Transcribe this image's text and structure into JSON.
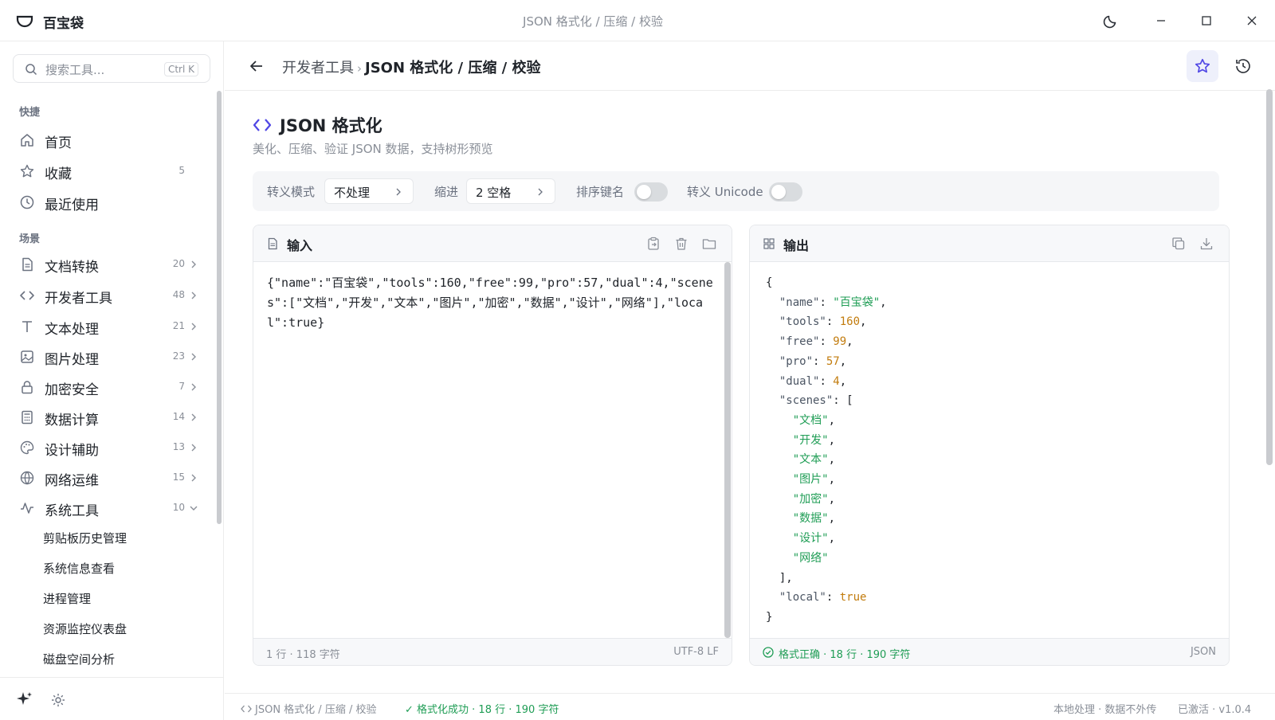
{
  "app": {
    "name": "百宝袋",
    "window_title": "JSON 格式化 / 压缩 / 校验"
  },
  "sidebar": {
    "search_placeholder": "搜索工具...",
    "search_shortcut": "Ctrl K",
    "quick_title": "快捷",
    "quick_items": [
      {
        "label": "首页",
        "icon": "home-icon"
      },
      {
        "label": "收藏",
        "icon": "star-icon",
        "count": "5"
      },
      {
        "label": "最近使用",
        "icon": "clock-icon"
      }
    ],
    "scene_title": "场景",
    "scene_items": [
      {
        "label": "文档转换",
        "icon": "document-icon",
        "count": "20"
      },
      {
        "label": "开发者工具",
        "icon": "code-icon",
        "count": "48"
      },
      {
        "label": "文本处理",
        "icon": "text-icon",
        "count": "21"
      },
      {
        "label": "图片处理",
        "icon": "image-icon",
        "count": "23"
      },
      {
        "label": "加密安全",
        "icon": "lock-icon",
        "count": "7"
      },
      {
        "label": "数据计算",
        "icon": "calculator-icon",
        "count": "14"
      },
      {
        "label": "设计辅助",
        "icon": "palette-icon",
        "count": "13"
      },
      {
        "label": "网络运维",
        "icon": "globe-icon",
        "count": "15"
      },
      {
        "label": "系统工具",
        "icon": "activity-icon",
        "count": "10",
        "expanded": true
      }
    ],
    "sub_items": [
      "剪贴板历史管理",
      "系统信息查看",
      "进程管理",
      "资源监控仪表盘",
      "磁盘空间分析"
    ]
  },
  "header": {
    "breadcrumb_parent": "开发者工具",
    "breadcrumb_sep": "›",
    "breadcrumb_current": "JSON 格式化 / 压缩 / 校验"
  },
  "tool": {
    "title": "JSON 格式化",
    "description": "美化、压缩、验证 JSON 数据，支持树形预览"
  },
  "options": {
    "escape_mode_label": "转义模式",
    "escape_mode_value": "不处理",
    "indent_label": "缩进",
    "indent_value": "2 空格",
    "sort_keys_label": "排序键名",
    "sort_keys_on": false,
    "unicode_label": "转义 Unicode",
    "unicode_on": false
  },
  "input_panel": {
    "title": "输入",
    "content": "{\"name\":\"百宝袋\",\"tools\":160,\"free\":99,\"pro\":57,\"dual\":4,\"scenes\":[\"文档\",\"开发\",\"文本\",\"图片\",\"加密\",\"数据\",\"设计\",\"网络\"],\"local\":true}",
    "footer_left": "1 行 · 118 字符",
    "footer_right": "UTF-8   LF"
  },
  "output_panel": {
    "title": "输出",
    "footer_left": "格式正确 · 18 行 · 190 字符",
    "footer_right": "JSON"
  },
  "output_json": {
    "name": "百宝袋",
    "tools": "160",
    "free": "99",
    "pro": "57",
    "dual": "4",
    "scenes": [
      "文档",
      "开发",
      "文本",
      "图片",
      "加密",
      "数据",
      "设计",
      "网络"
    ],
    "local": "true"
  },
  "statusbar": {
    "left": "JSON 格式化 / 压缩 / 校验",
    "success": "✓ 格式化成功 · 18 行 · 190 字符",
    "right1": "本地处理 · 数据不外传",
    "right2": "已激活 · v1.0.4"
  },
  "colors": {
    "accent": "#4f46e5",
    "success": "#1f9d55",
    "number": "#c27c0e"
  }
}
